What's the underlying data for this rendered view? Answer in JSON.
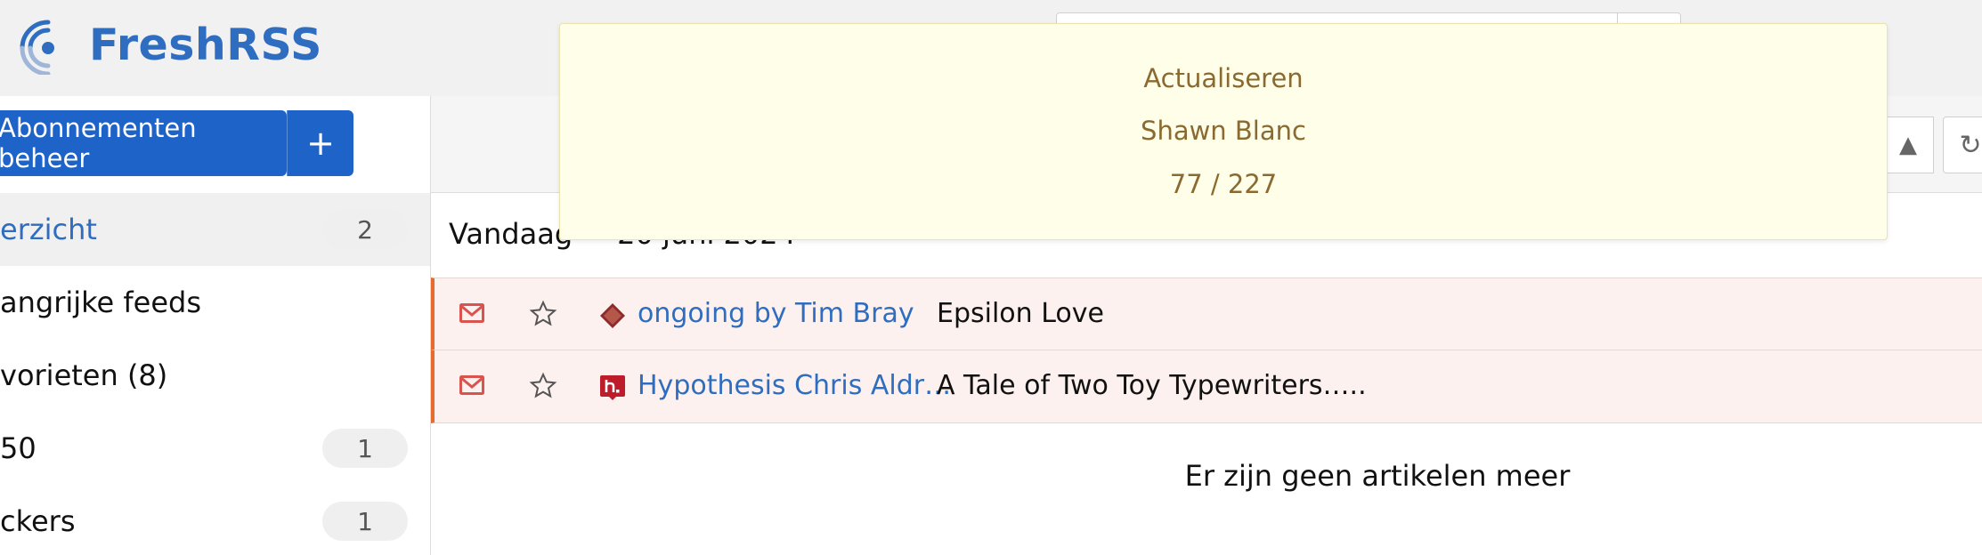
{
  "header": {
    "app_name": "FreshRSS",
    "logo_icon": "freshrss-logo-icon",
    "brand_color": "#2e6dbf"
  },
  "sidebar": {
    "manage_button": "Abonnementen beheer",
    "add_button": "+",
    "items": [
      {
        "label": "erzicht",
        "count": "2",
        "active": true
      },
      {
        "label": "angrijke feeds",
        "count": ""
      },
      {
        "label": "vorieten (8)",
        "count": ""
      },
      {
        "label": "50",
        "count": "1"
      },
      {
        "label": "ckers",
        "count": "1"
      }
    ],
    "button_color": "#1e63c8"
  },
  "toolbar": {
    "up_icon": "triangle-up-icon",
    "refresh_icon": "refresh-icon"
  },
  "main": {
    "day_label": "Vandaag",
    "day_date": "20 juni 2024",
    "articles": [
      {
        "feed": "ongoing by Tim Bray",
        "title": "Epsilon Love",
        "feed_icon": "diamond-feed-icon",
        "unread": true
      },
      {
        "feed": "Hypothesis Chris Aldr…",
        "title": "A Tale of Two Toy Typewriters…..",
        "feed_icon": "hypothesis-icon",
        "unread": true
      }
    ],
    "no_more": "Er zijn geen artikelen meer",
    "unread_accent": "#e76b2f"
  },
  "notification": {
    "title": "Actualiseren",
    "feed": "Shawn Blanc",
    "progress": "77 / 227"
  }
}
